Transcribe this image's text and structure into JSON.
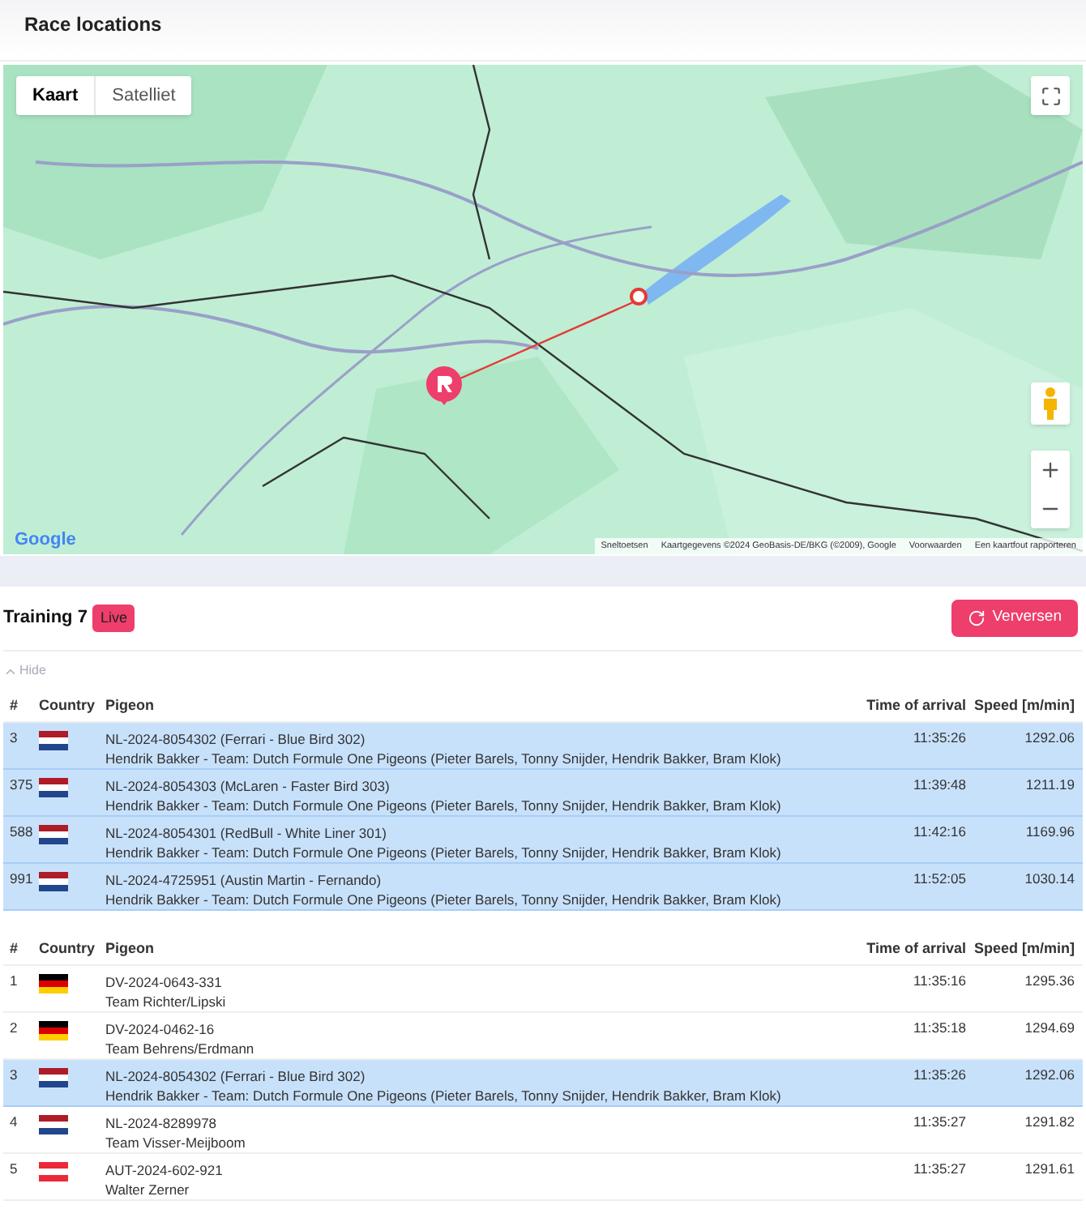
{
  "page_title": "Race locations",
  "map": {
    "tabs": [
      {
        "label": "Kaart",
        "selected": true
      },
      {
        "label": "Satelliet",
        "selected": false
      }
    ],
    "logo": "Google",
    "attribution": [
      "Sneltoetsen",
      "Kaartgegevens ©2024 GeoBasis-DE/BKG (©2009), Google",
      "Voorwaarden",
      "Een kaartfout rapporteren"
    ]
  },
  "race": {
    "title": "Training 7",
    "badge": "Live",
    "button": "Verversen",
    "toggle": "Hide"
  },
  "tables": [
    {
      "columns": [
        "#",
        "Country",
        "Pigeon",
        "Time of arrival",
        "Speed [m/min]"
      ],
      "rows": [
        {
          "rank": "3",
          "kind": "nl",
          "ring": "NL-2024-8054302 (Ferrari - Blue Bird 302)",
          "owner": "Hendrik Bakker - Team: Dutch Formule One Pigeons (Pieter Barels, Tonny Snijder, Hendrik Bakker, Bram Klok)",
          "time": "11:35:26",
          "speed": "1292.06",
          "selected": true
        },
        {
          "rank": "375",
          "kind": "nl",
          "ring": "NL-2024-8054303 (McLaren - Faster Bird 303)",
          "owner": "Hendrik Bakker - Team: Dutch Formule One Pigeons (Pieter Barels, Tonny Snijder, Hendrik Bakker, Bram Klok)",
          "time": "11:39:48",
          "speed": "1211.19",
          "selected": true
        },
        {
          "rank": "588",
          "kind": "nl",
          "ring": "NL-2024-8054301 (RedBull - White Liner 301)",
          "owner": "Hendrik Bakker - Team: Dutch Formule One Pigeons (Pieter Barels, Tonny Snijder, Hendrik Bakker, Bram Klok)",
          "time": "11:42:16",
          "speed": "1169.96",
          "selected": true
        },
        {
          "rank": "991",
          "kind": "nl",
          "ring": "NL-2024-4725951 (Austin Martin - Fernando)",
          "owner": "Hendrik Bakker - Team: Dutch Formule One Pigeons (Pieter Barels, Tonny Snijder, Hendrik Bakker, Bram Klok)",
          "time": "11:52:05",
          "speed": "1030.14",
          "selected": true
        }
      ]
    },
    {
      "columns": [
        "#",
        "Country",
        "Pigeon",
        "Time of arrival",
        "Speed [m/min]"
      ],
      "rows": [
        {
          "rank": "1",
          "kind": "de",
          "ring": "DV-2024-0643-331",
          "owner": "Team Richter/Lipski",
          "time": "11:35:16",
          "speed": "1295.36",
          "selected": false
        },
        {
          "rank": "2",
          "kind": "de",
          "ring": "DV-2024-0462-16",
          "owner": "Team Behrens/Erdmann",
          "time": "11:35:18",
          "speed": "1294.69",
          "selected": false
        },
        {
          "rank": "3",
          "kind": "nl",
          "ring": "NL-2024-8054302 (Ferrari - Blue Bird 302)",
          "owner": "Hendrik Bakker - Team: Dutch Formule One Pigeons (Pieter Barels, Tonny Snijder, Hendrik Bakker, Bram Klok)",
          "time": "11:35:26",
          "speed": "1292.06",
          "selected": true
        },
        {
          "rank": "4",
          "kind": "nl",
          "ring": "NL-2024-8289978",
          "owner": "Team Visser-Meijboom",
          "time": "11:35:27",
          "speed": "1291.82",
          "selected": false
        },
        {
          "rank": "5",
          "kind": "at",
          "ring": "AUT-2024-602-921",
          "owner": "Walter Zerner",
          "time": "11:35:27",
          "speed": "1291.61",
          "selected": false
        }
      ]
    }
  ]
}
